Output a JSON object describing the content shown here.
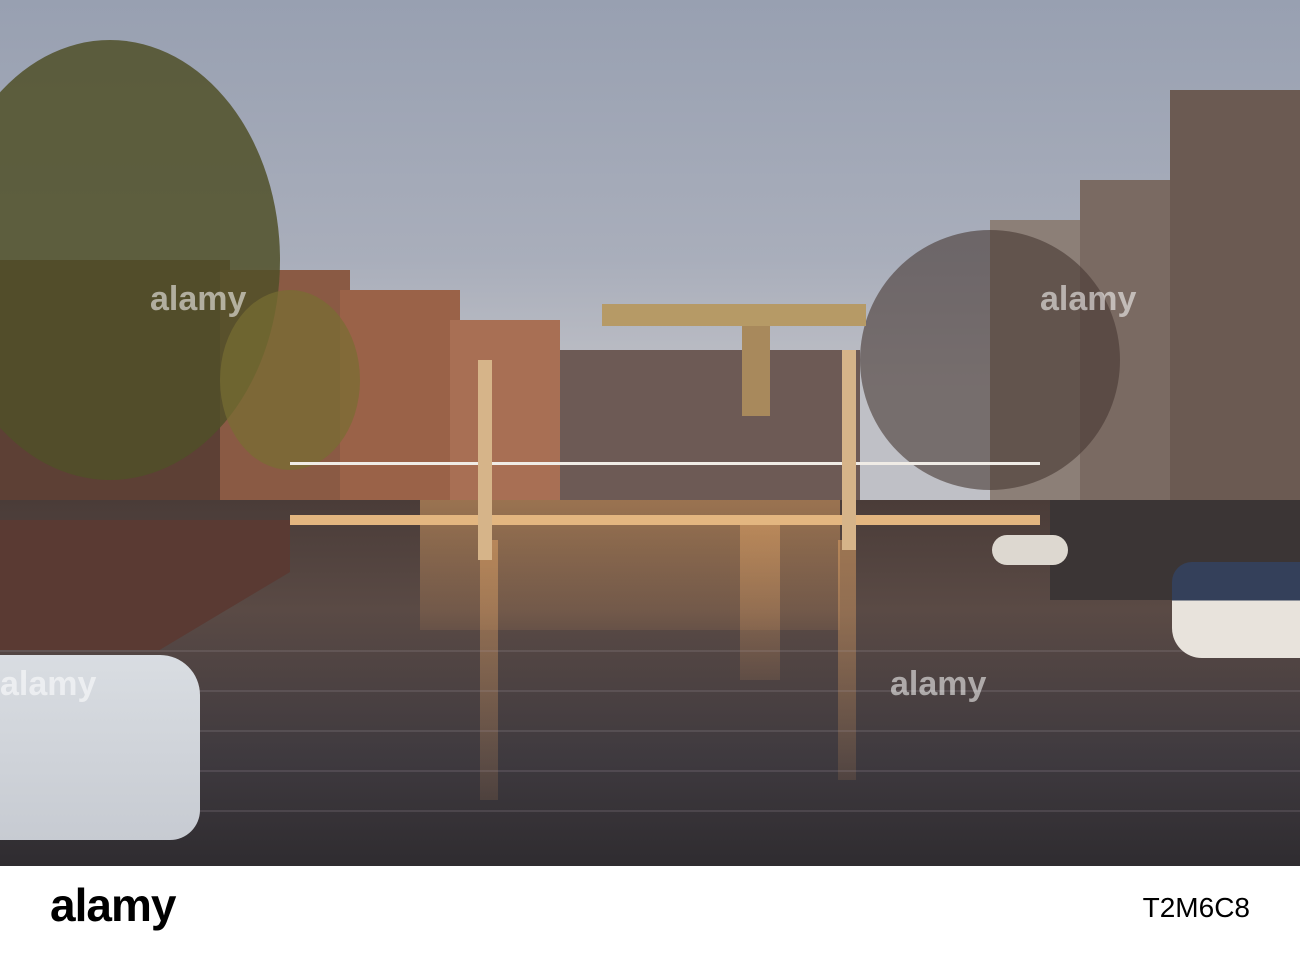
{
  "photo": {
    "subject": "canal-with-drawbridge",
    "colors": {
      "sky": "#a9aebb",
      "water": "#4a3c38",
      "glow": "#d9a070"
    }
  },
  "watermark": {
    "logo": "alamy",
    "image_id": "T2M6C8"
  }
}
